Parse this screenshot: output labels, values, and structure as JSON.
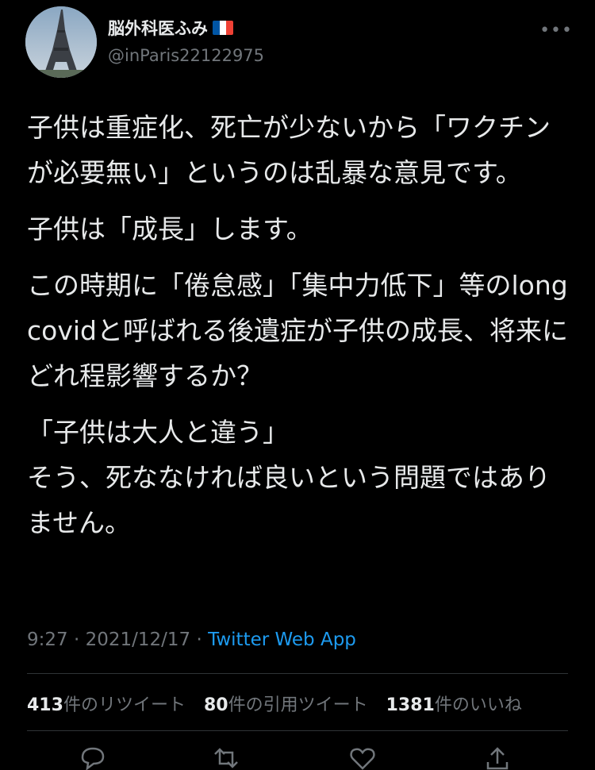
{
  "author": {
    "display_name": "脳外科医ふみ",
    "handle": "@inParis22122975",
    "flag_colors": [
      "#0055a4",
      "#ffffff",
      "#ef4135"
    ]
  },
  "tweet": {
    "paragraphs": [
      "子供は重症化、死亡が少ないから「ワクチンが必要無い」というのは乱暴な意見です。",
      "子供は「成長」します。",
      "この時期に「倦怠感」「集中力低下」等のlong covidと呼ばれる後遺症が子供の成長、将来にどれ程影響するか？",
      "「子供は大人と違う」\nそう、死ななければ良いという問題ではありません。"
    ]
  },
  "meta": {
    "time": "9:27",
    "separator": " · ",
    "date": "2021/12/17",
    "source": "Twitter Web App"
  },
  "stats": {
    "retweets_count": "413",
    "retweets_label": "件のリツイート",
    "quotes_count": "80",
    "quotes_label": "件の引用ツイート",
    "likes_count": "1381",
    "likes_label": "件のいいね"
  },
  "icons": [
    "more-icon",
    "reply-icon",
    "retweet-icon",
    "like-icon",
    "share-icon"
  ],
  "colors": {
    "background": "#000000",
    "text": "#e7e9ea",
    "muted": "#71767b",
    "link": "#1d9bf0",
    "divider": "#2f3336"
  }
}
